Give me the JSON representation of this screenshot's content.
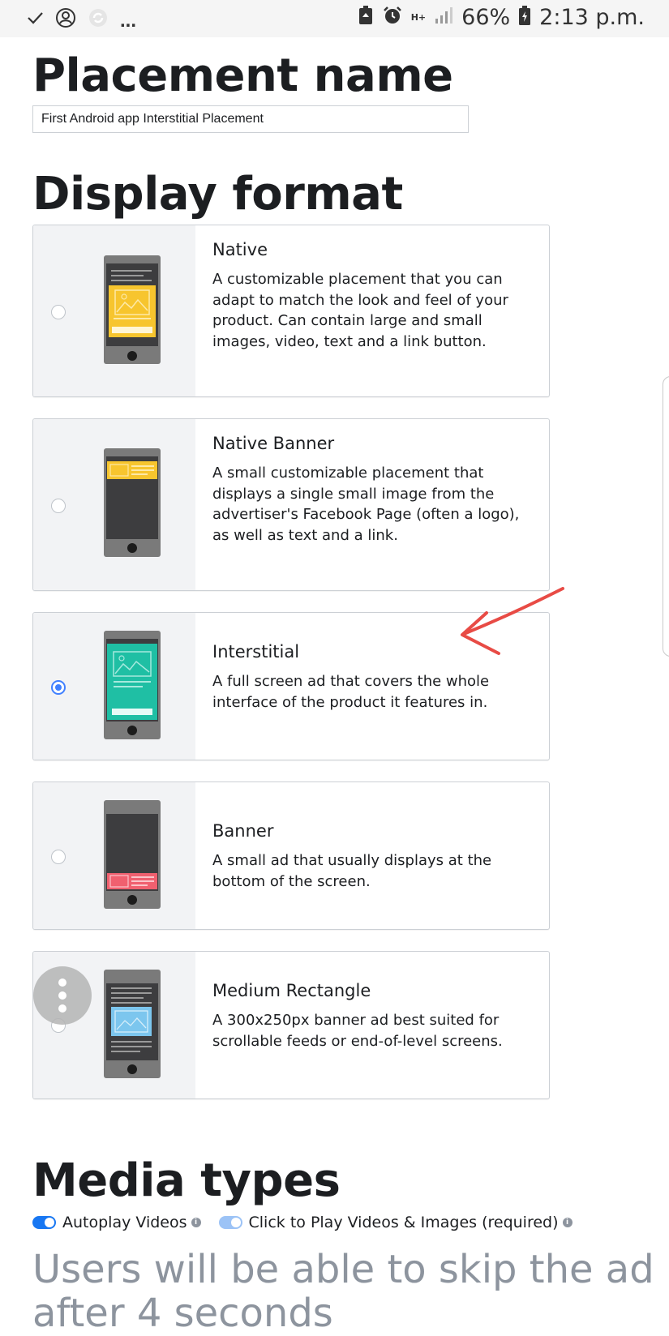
{
  "status_bar": {
    "left_icons": [
      "check-icon",
      "account-icon",
      "sync-icon"
    ],
    "overflow": "...",
    "network": "H+",
    "battery": "66%",
    "time": "2:13 p.m."
  },
  "placement": {
    "heading": "Placement name",
    "input_value": "First Android app Interstitial Placement"
  },
  "display_format": {
    "heading": "Display format",
    "options": [
      {
        "title": "Native",
        "description": "A customizable placement that you can adapt to match the look and feel of your product. Can contain large and small images, video, text and a link button.",
        "selected": false,
        "accent": "#f7c52e"
      },
      {
        "title": "Native Banner",
        "description": "A small customizable placement that displays a single small image from the advertiser's Facebook Page (often a logo), as well as text and a link.",
        "selected": false,
        "accent": "#f7c52e"
      },
      {
        "title": "Interstitial",
        "description": "A full screen ad that covers the whole interface of the product it features in.",
        "selected": true,
        "accent": "#1fbfa4"
      },
      {
        "title": "Banner",
        "description": "A small ad that usually displays at the bottom of the screen.",
        "selected": false,
        "accent": "#f0606f"
      },
      {
        "title": "Medium Rectangle",
        "description": "A 300x250px banner ad best suited for scrollable feeds or end-of-level screens.",
        "selected": false,
        "accent": "#7cc6ee"
      }
    ]
  },
  "media_types": {
    "heading": "Media types",
    "autoplay_label": "Autoplay Videos",
    "autoplay_on": true,
    "click_to_play_label": "Click to Play Videos & Images (required)",
    "click_to_play_on": true,
    "skip_text": "Users will be able to skip the ad",
    "skip_text_cont": "after 4 seconds"
  },
  "colors": {
    "accent_blue": "#4080ff",
    "annotation_red": "#e84b45"
  }
}
